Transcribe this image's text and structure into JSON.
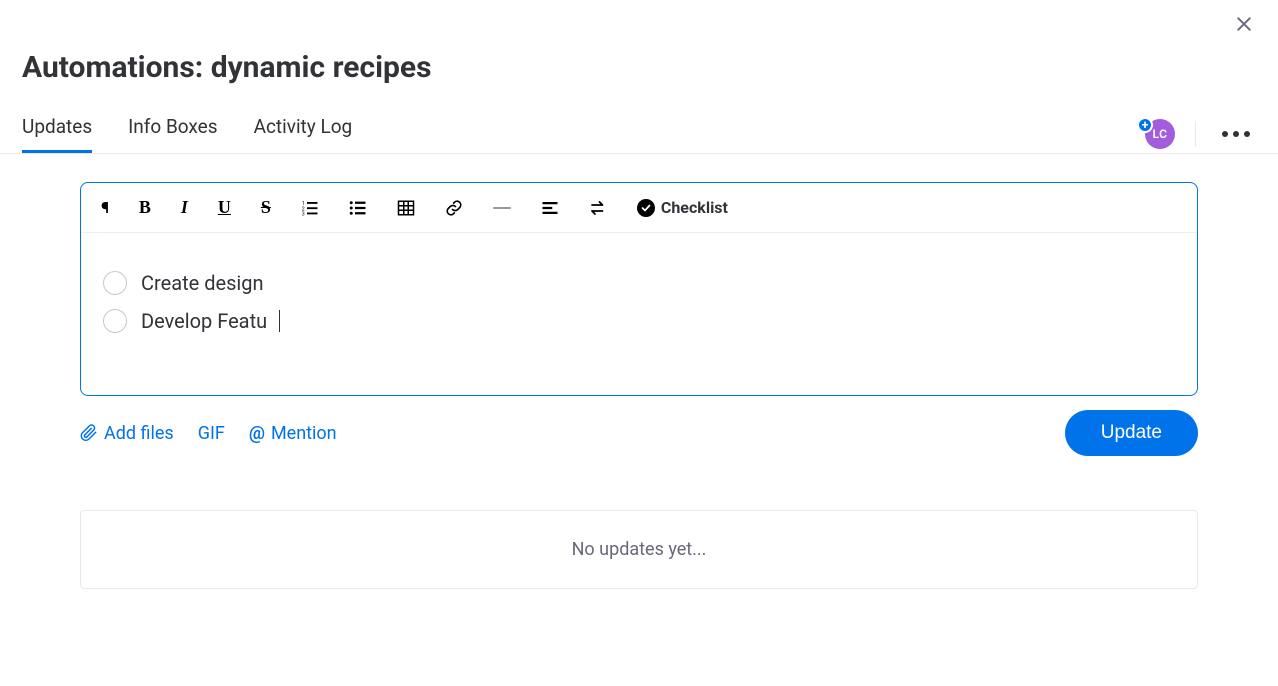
{
  "header": {
    "title": "Automations: dynamic recipes"
  },
  "tabs": {
    "items": [
      {
        "label": "Updates",
        "active": true
      },
      {
        "label": "Info Boxes",
        "active": false
      },
      {
        "label": "Activity Log",
        "active": false
      }
    ]
  },
  "avatar": {
    "initials": "LC"
  },
  "toolbar": {
    "bold": "B",
    "italic": "I",
    "underline": "U",
    "strike": "S",
    "checklist_label": "Checklist"
  },
  "editor": {
    "checklist": [
      {
        "text": "Create design",
        "checked": false
      },
      {
        "text": "Develop Featu",
        "checked": false,
        "cursor": true
      }
    ]
  },
  "footer": {
    "add_files": "Add files",
    "gif": "GIF",
    "mention": "Mention",
    "update_button": "Update"
  },
  "empty_state": {
    "text": "No updates yet..."
  }
}
